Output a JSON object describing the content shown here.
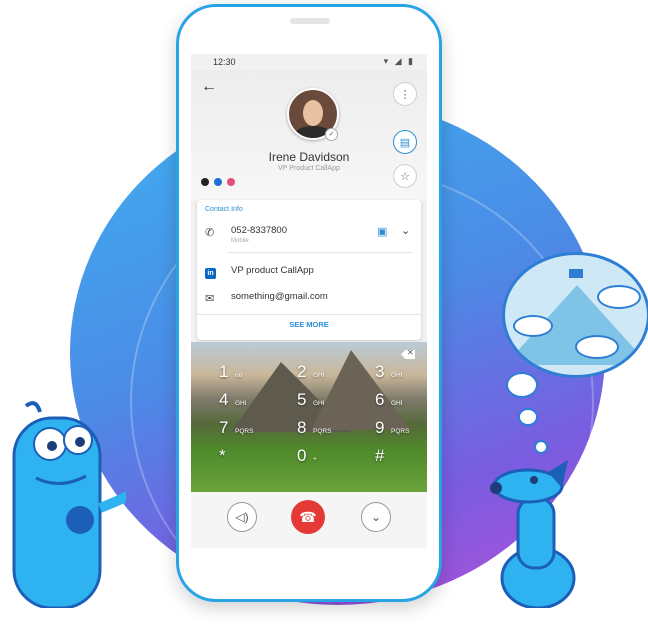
{
  "colors": {
    "accent": "#2b8fd6",
    "end_call": "#e53935",
    "linkedin": "#0a66c2"
  },
  "status_bar": {
    "time": "12:30"
  },
  "contact": {
    "name": "Irene Davidson",
    "title": "VP Product CallApp",
    "color_dots": [
      "#222222",
      "#1e6fd0",
      "#e0527a"
    ]
  },
  "contact_info": {
    "heading": "Contact Info",
    "phone": {
      "number": "052-8337800",
      "type": "Mobile"
    },
    "linkedin": "VP product CallApp",
    "email": "something@gmail.com",
    "see_more": "SEE MORE"
  },
  "keypad": [
    {
      "digit": "1",
      "letters": "oo"
    },
    {
      "digit": "2",
      "letters": "GHI"
    },
    {
      "digit": "3",
      "letters": "GHI"
    },
    {
      "digit": "4",
      "letters": "GHI"
    },
    {
      "digit": "5",
      "letters": "GHI"
    },
    {
      "digit": "6",
      "letters": "GHI"
    },
    {
      "digit": "7",
      "letters": "PQRS"
    },
    {
      "digit": "8",
      "letters": "PQRS"
    },
    {
      "digit": "9",
      "letters": "PQRS"
    },
    {
      "digit": "*",
      "letters": ""
    },
    {
      "digit": "0",
      "letters": "+"
    },
    {
      "digit": "#",
      "letters": ""
    }
  ],
  "icons": {
    "back": "back-arrow-icon",
    "more": "more-vert-icon",
    "note": "note-icon",
    "star": "star-icon",
    "phone": "phone-icon",
    "chat": "chat-icon",
    "expand": "chevron-down-icon",
    "mail": "mail-icon",
    "backspace": "backspace-icon",
    "speaker": "speaker-icon",
    "end_call": "end-call-icon",
    "collapse": "chevron-down-icon"
  }
}
